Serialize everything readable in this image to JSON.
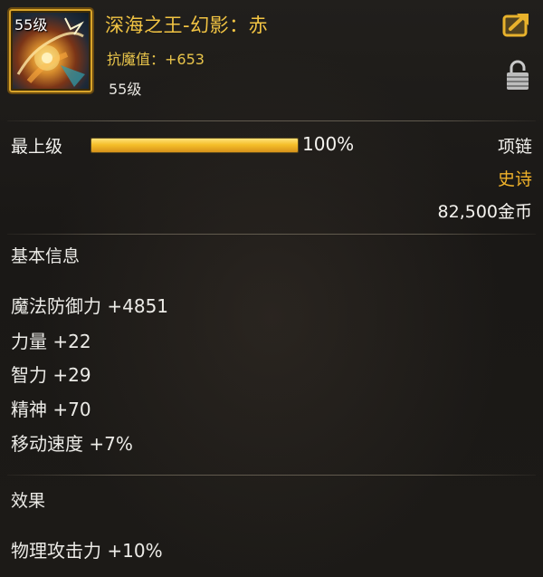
{
  "item": {
    "icon": "deep-sea-king-necklace-icon",
    "icon_level": "55级",
    "name": "深海之王-幻影：赤",
    "resist": "抗魔值：+653",
    "required_level": "55级",
    "type": "项链",
    "rarity": "史诗",
    "price": "82,500金币"
  },
  "upgrade": {
    "label": "最上级",
    "percent_text": "100%",
    "progress": 1.0
  },
  "basic_info": {
    "title": "基本信息",
    "stats": [
      "魔法防御力 +4851",
      "力量 +22",
      "智力 +29",
      "精神 +70",
      "移动速度 +7%"
    ]
  },
  "effects": {
    "title": "效果",
    "lines": [
      "物理攻击力 +10%"
    ]
  },
  "colors": {
    "gold": "#f2c443",
    "rarity_epic": "#f0b22a",
    "text": "#ecebe7"
  },
  "buttons": {
    "share_icon": "share-arrow-icon",
    "lock_icon": "lock-icon"
  }
}
